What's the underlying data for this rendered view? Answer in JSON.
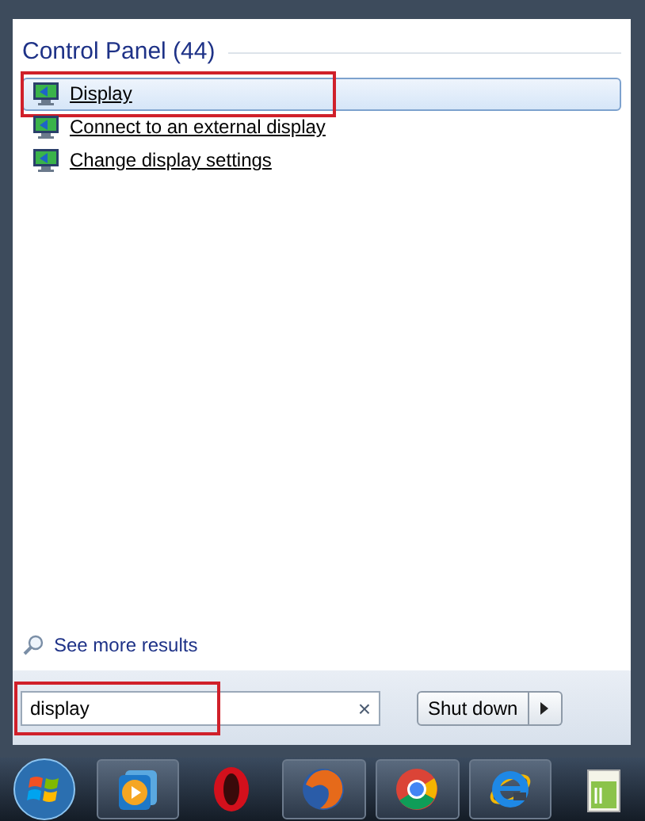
{
  "section": {
    "title": "Control Panel (44)"
  },
  "results": [
    {
      "label": "Display",
      "selected": true,
      "annotated": true
    },
    {
      "label": "Connect to an external display",
      "selected": false,
      "annotated": false
    },
    {
      "label": "Change display settings",
      "selected": false,
      "annotated": false
    }
  ],
  "see_more": "See more results",
  "search": {
    "value": "display",
    "annotated": true,
    "clear": "×"
  },
  "shutdown": {
    "label": "Shut down"
  },
  "taskbar": {
    "items": [
      {
        "kind": "start",
        "open": false
      },
      {
        "kind": "player",
        "open": true
      },
      {
        "kind": "opera",
        "open": false
      },
      {
        "kind": "firefox",
        "open": true
      },
      {
        "kind": "chrome",
        "open": true
      },
      {
        "kind": "ie",
        "open": true
      },
      {
        "kind": "notepad",
        "open": false
      }
    ]
  }
}
